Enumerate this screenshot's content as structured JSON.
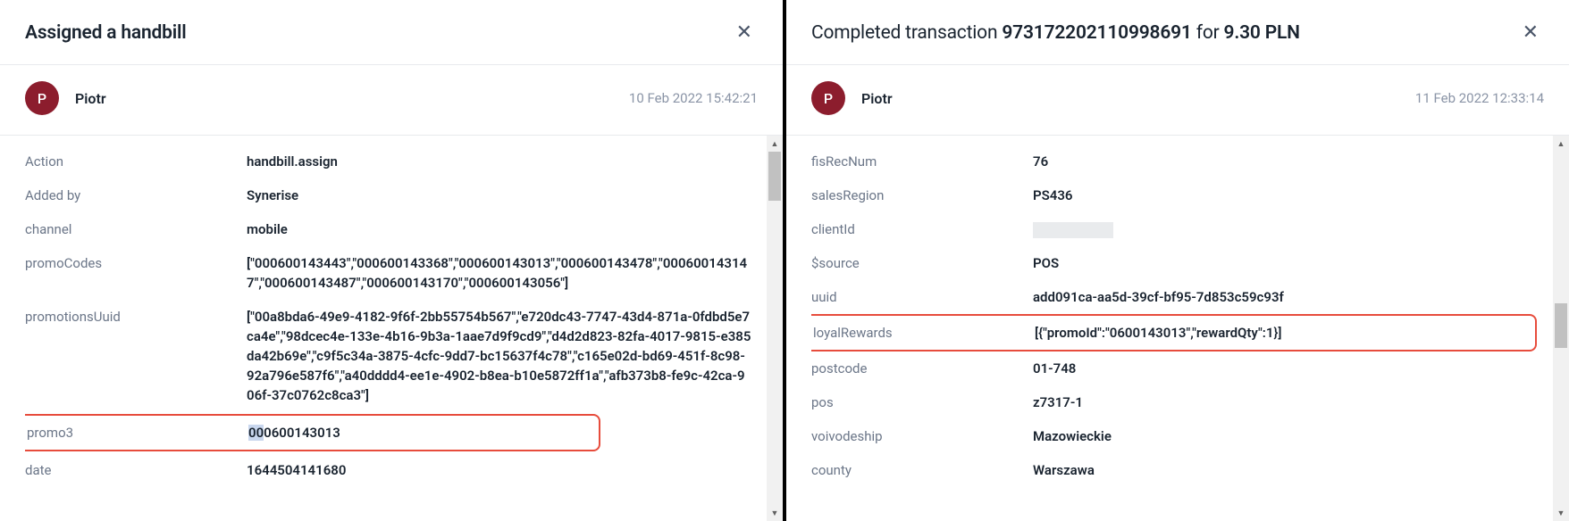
{
  "left": {
    "title": "Assigned a handbill",
    "avatar_initial": "P",
    "username": "Piotr",
    "timestamp": "10 Feb 2022 15:42:21",
    "rows": {
      "action_k": "Action",
      "action_v": "handbill.assign",
      "addedby_k": "Added by",
      "addedby_v": "Synerise",
      "channel_k": "channel",
      "channel_v": "mobile",
      "promocodes_k": "promoCodes",
      "promocodes_v": "[\"000600143443\",\"000600143368\",\"000600143013\",\"000600143478\",\"000600143147\",\"000600143487\",\"000600143170\",\"000600143056\"]",
      "promouuid_k": "promotionsUuid",
      "promouuid_v": "[\"00a8bda6-49e9-4182-9f6f-2bb55754b567\",\"e720dc43-7747-43d4-871a-0fdbd5e7ca4e\",\"98dcec4e-133e-4b16-9b3a-1aae7d9f9cd9\",\"d4d2d823-82fa-4017-9815-e385da42b69e\",\"c9f5c34a-3875-4cfc-9dd7-bc15637f4c78\",\"c165e02d-bd69-451f-8c98-92a796e587f6\",\"a40dddd4-ee1e-4902-b8ea-b10e5872ff1a\",\"afb373b8-fe9c-42ca-906f-37c0762c8ca3\"]",
      "promo3_k": "promo3",
      "promo3_v_sel": "00",
      "promo3_v_rest": "0600143013",
      "date_k": "date",
      "date_v": "1644504141680"
    }
  },
  "right": {
    "title_pre": "Completed transaction ",
    "title_txid": "973172202110998691",
    "title_mid": " for ",
    "title_amt": "9.30 PLN",
    "avatar_initial": "P",
    "username": "Piotr",
    "timestamp": "11 Feb 2022 12:33:14",
    "rows": {
      "fisrec_k": "fisRecNum",
      "fisrec_v": "76",
      "salesreg_k": "salesRegion",
      "salesreg_v": "PS436",
      "clientid_k": "clientId",
      "source_k": "$source",
      "source_v": "POS",
      "uuid_k": "uuid",
      "uuid_v": "add091ca-aa5d-39cf-bf95-7d853c59c93f",
      "loyal_k": "loyalRewards",
      "loyal_v": "[{\"promoId\":\"0600143013\",\"rewardQty\":1}]",
      "postcode_k": "postcode",
      "postcode_v": "01-748",
      "pos_k": "pos",
      "pos_v": "z7317-1",
      "voiv_k": "voivodeship",
      "voiv_v": "Mazowieckie",
      "county_k": "county",
      "county_v": "Warszawa"
    }
  }
}
